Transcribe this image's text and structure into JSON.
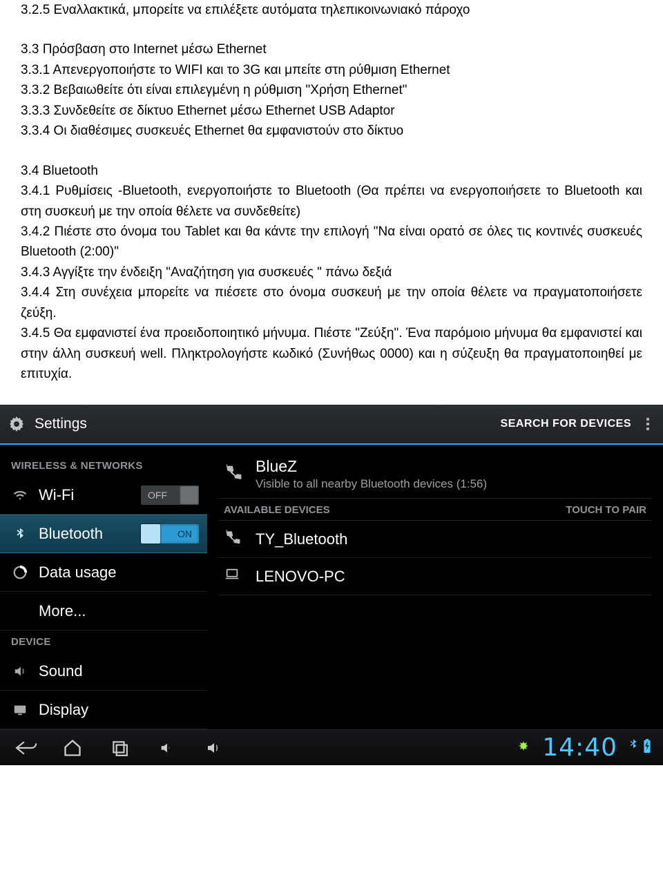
{
  "doc": {
    "p325": "3.2.5 Εναλλακτικά, μπορείτε να επιλέξετε αυτόματα τηλεπικοινωνιακό πάροχο",
    "h33": "3.3 Πρόσβαση στο Internet μέσω Ethernet",
    "p331": "3.3.1 Απενεργοποιήστε το WIFI και το 3G και μπείτε στη ρύθμιση Ethernet",
    "p332": "3.3.2 Βεβαιωθείτε ότι είναι επιλεγμένη η ρύθμιση \"Χρήση Ethernet\"",
    "p333": "3.3.3 Συνδεθείτε σε δίκτυο Ethernet μέσω Ethernet USB Adaptor",
    "p334": "3.3.4 Οι διαθέσιμες συσκευές Ethernet θα εμφανιστούν στο δίκτυο",
    "h34": "3.4 Bluetooth",
    "p341": "3.4.1 Ρυθμίσεις -Bluetooth, ενεργοποιήστε το Bluetooth (Θα πρέπει να ενεργοποιήσετε το Bluetooth και στη συσκευή με την οποία θέλετε να συνδεθείτε)",
    "p342": "3.4.2 Πιέστε στο όνομα του Tablet και θα κάντε την επιλογή \"Να είναι ορατό σε όλες τις κοντινές συσκευές Bluetooth (2:00)\"",
    "p343": "3.4.3 Αγγίξτε την ένδειξη \"Αναζήτηση για συσκευές \" πάνω δεξιά",
    "p344": "3.4.4 Στη συνέχεια μπορείτε να πιέσετε στο όνομα συσκευή με την οποία θέλετε να πραγματοποιήσετε ζεύξη.",
    "p345": "3.4.5 Θα εμφανιστεί ένα προειδοποιητικό μήνυμα. Πιέστε \"Ζεύξη\". Ένα παρόμοιο μήνυμα θα εμφανιστεί και στην άλλη συσκευή well. Πληκτρολογήστε κωδικό (Συνήθως 0000) και η σύζευξη θα πραγματοποιηθεί με επιτυχία."
  },
  "settings": {
    "title": "Settings",
    "search_action": "SEARCH FOR DEVICES",
    "sections": {
      "wireless": "WIRELESS & NETWORKS",
      "device": "DEVICE"
    },
    "side": {
      "wifi": {
        "label": "Wi-Fi",
        "toggle": "OFF"
      },
      "bt": {
        "label": "Bluetooth",
        "toggle": "ON"
      },
      "data": {
        "label": "Data usage"
      },
      "more": {
        "label": "More..."
      },
      "sound": {
        "label": "Sound"
      },
      "display": {
        "label": "Display"
      }
    },
    "own": {
      "name": "BlueZ",
      "sub": "Visible to all nearby Bluetooth devices (1:56)"
    },
    "headers": {
      "available": "AVAILABLE DEVICES",
      "touch": "TOUCH TO PAIR"
    },
    "devices": [
      {
        "name": "TY_Bluetooth",
        "kind": "phone"
      },
      {
        "name": "LENOVO-PC",
        "kind": "laptop"
      }
    ]
  },
  "navbar": {
    "clock": "14:40"
  }
}
